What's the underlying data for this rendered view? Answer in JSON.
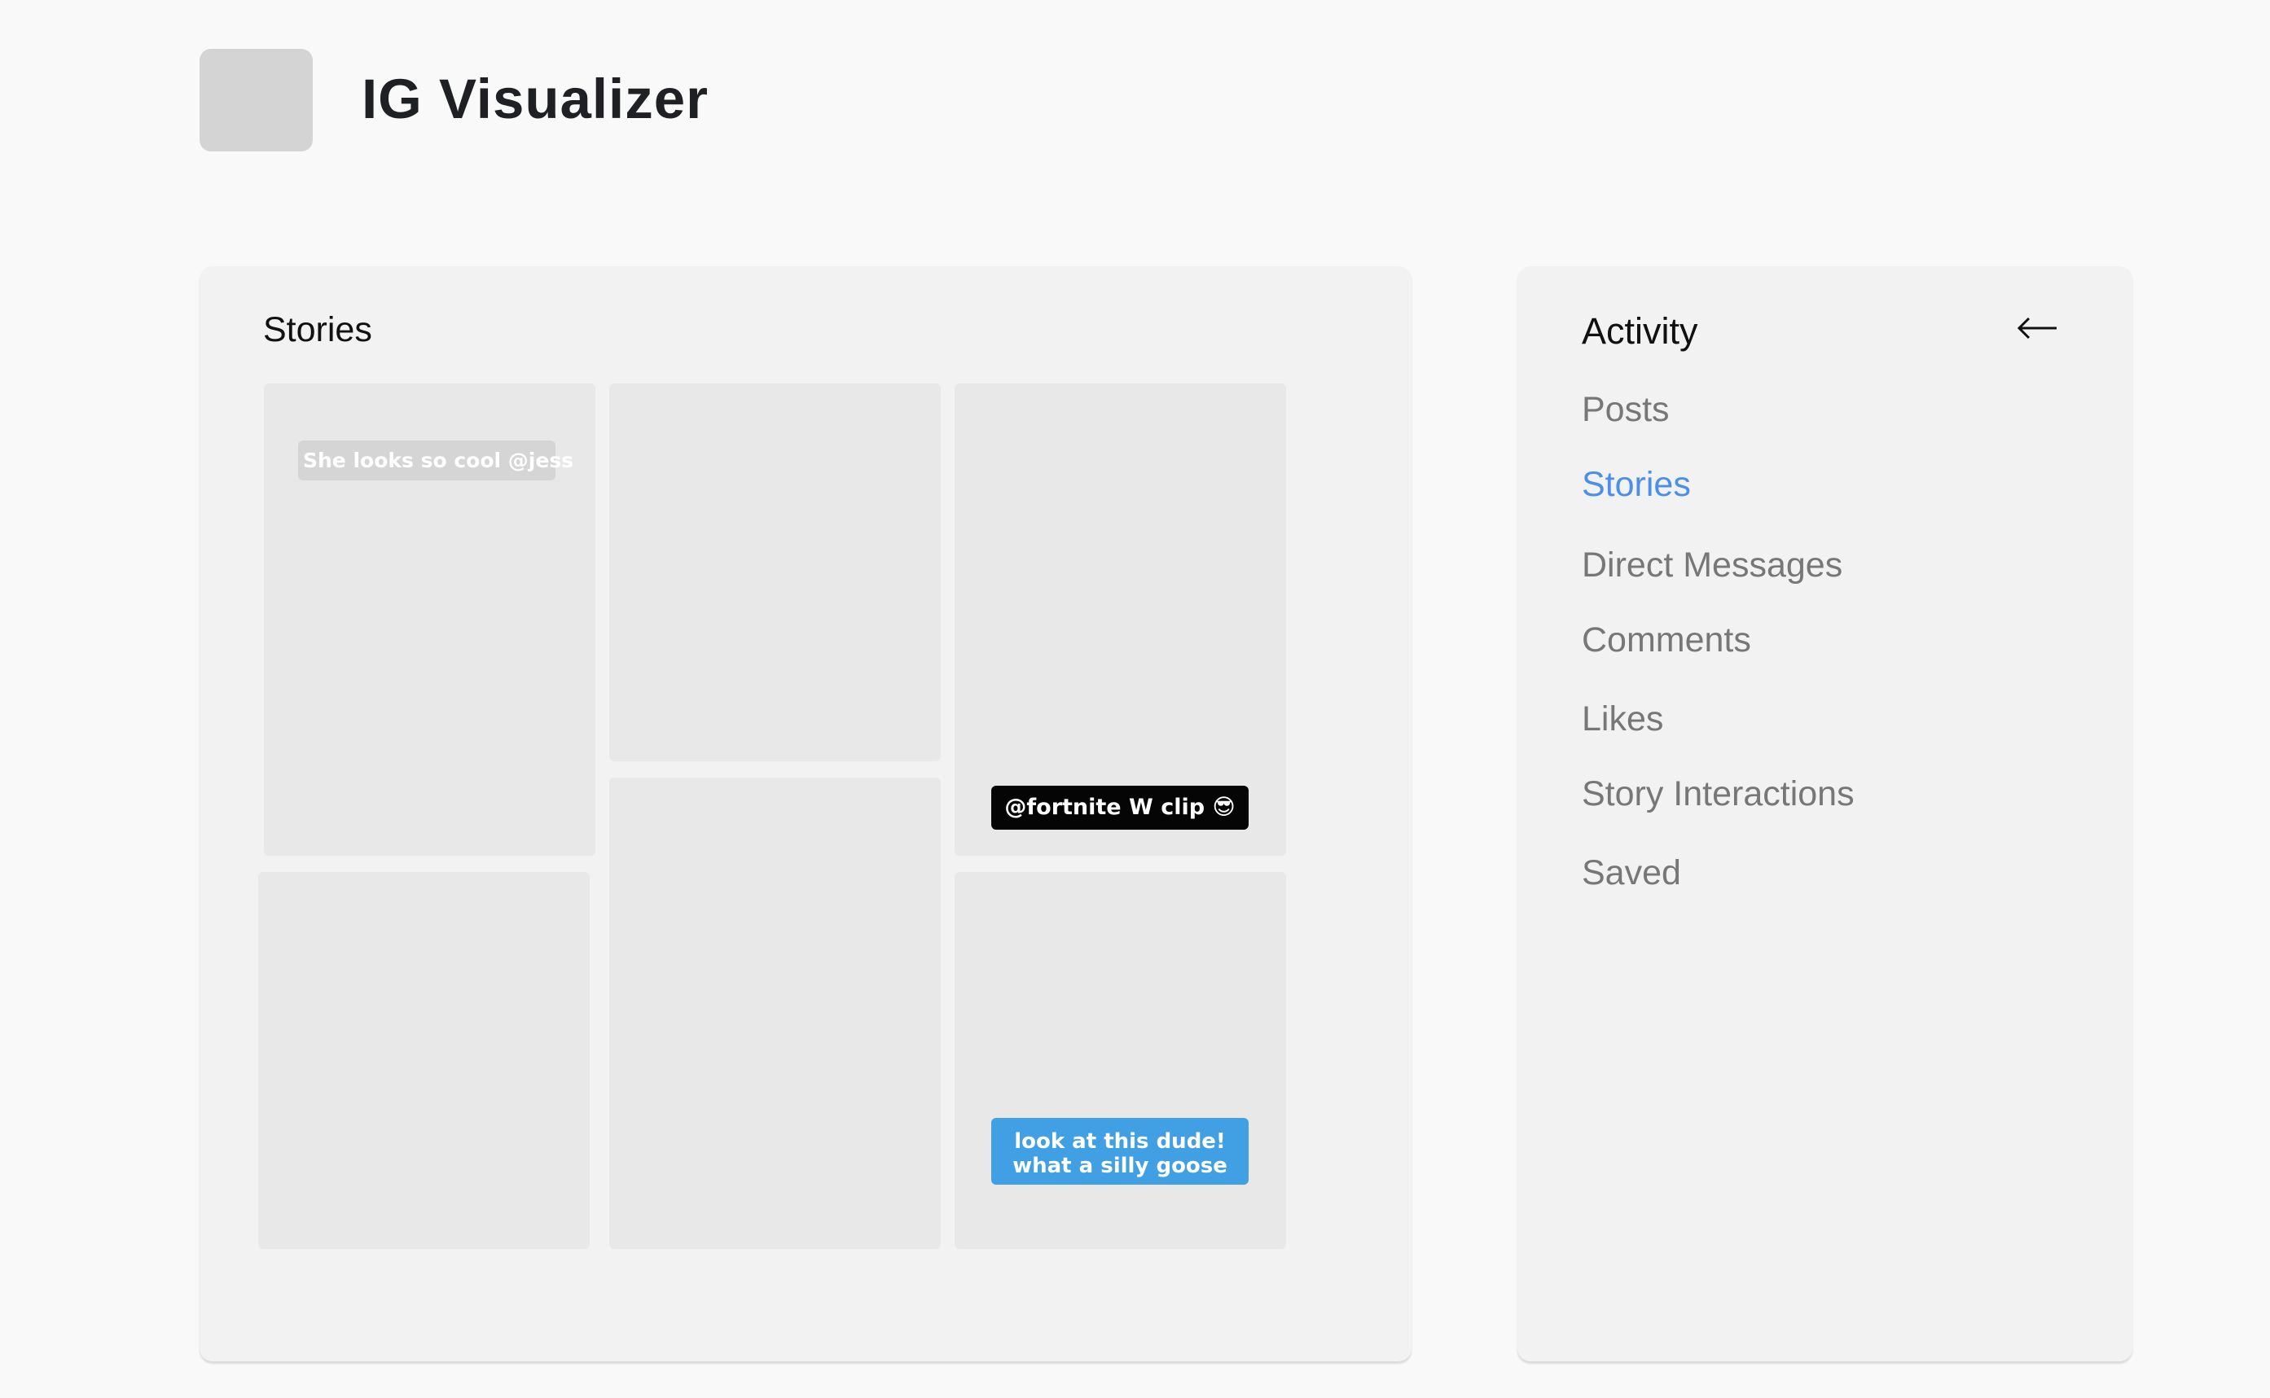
{
  "header": {
    "app_title": "IG Visualizer"
  },
  "stories": {
    "title": "Stories",
    "captions": {
      "tile1": "She looks so cool @jess",
      "tile3": "@fortnite W clip 😎",
      "tile6_line1": "look at this dude!",
      "tile6_line2": "what a silly goose"
    }
  },
  "activity": {
    "title": "Activity",
    "back_icon": "arrow-left-icon",
    "nav": {
      "posts": "Posts",
      "stories": "Stories",
      "direct_messages": "Direct Messages",
      "comments": "Comments",
      "likes": "Likes",
      "story_interactions": "Story Interactions",
      "saved": "Saved"
    },
    "active_item": "Stories"
  },
  "colors": {
    "accent": "#4b8fe8",
    "caption_blue": "#41a0e4",
    "caption_black": "#050505"
  }
}
